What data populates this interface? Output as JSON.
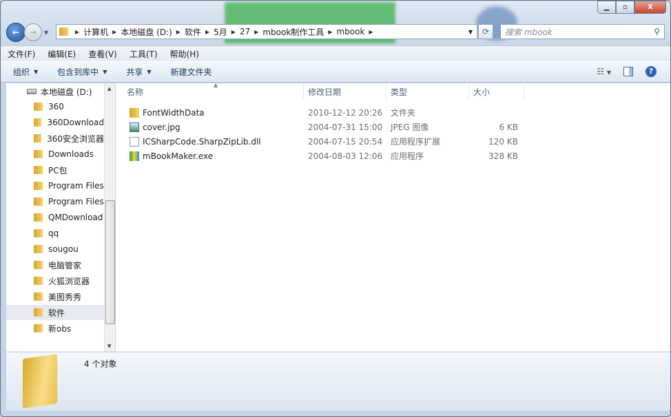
{
  "window": {
    "controls": [
      "minimize",
      "maximize",
      "close"
    ]
  },
  "address": {
    "crumbs": [
      "计算机",
      "本地磁盘 (D:)",
      "软件",
      "5月",
      "27",
      "mbook制作工具",
      "mbook"
    ]
  },
  "search": {
    "placeholder": "搜索 mbook"
  },
  "menu": [
    "文件(F)",
    "编辑(E)",
    "查看(V)",
    "工具(T)",
    "帮助(H)"
  ],
  "toolbar": {
    "organize": "组织",
    "include": "包含到库中",
    "share": "共享",
    "new_folder": "新建文件夹"
  },
  "sidebar": {
    "drive": "本地磁盘 (D:)",
    "items": [
      "360",
      "360Download",
      "360安全浏览器",
      "Downloads",
      "PC包",
      "Program Files",
      "Program Files",
      "QMDownload",
      "qq",
      "sougou",
      "电脑管家",
      "火狐浏览器",
      "美图秀秀",
      "软件",
      "新obs"
    ],
    "selected": "软件"
  },
  "columns": {
    "name": "名称",
    "date": "修改日期",
    "type": "类型",
    "size": "大小"
  },
  "files": [
    {
      "name": "FontWidthData",
      "date": "2010-12-12 20:26",
      "type": "文件夹",
      "size": "",
      "icon": "folder-icon"
    },
    {
      "name": "cover.jpg",
      "date": "2004-07-31 15:00",
      "type": "JPEG 图像",
      "size": "6 KB",
      "icon": "image-file-icon"
    },
    {
      "name": "ICSharpCode.SharpZipLib.dll",
      "date": "2004-07-15 20:54",
      "type": "应用程序扩展",
      "size": "120 KB",
      "icon": "dll-file-icon"
    },
    {
      "name": "mBookMaker.exe",
      "date": "2004-08-03 12:06",
      "type": "应用程序",
      "size": "328 KB",
      "icon": "exe-file-icon"
    }
  ],
  "status": {
    "count": "4 个对象"
  }
}
